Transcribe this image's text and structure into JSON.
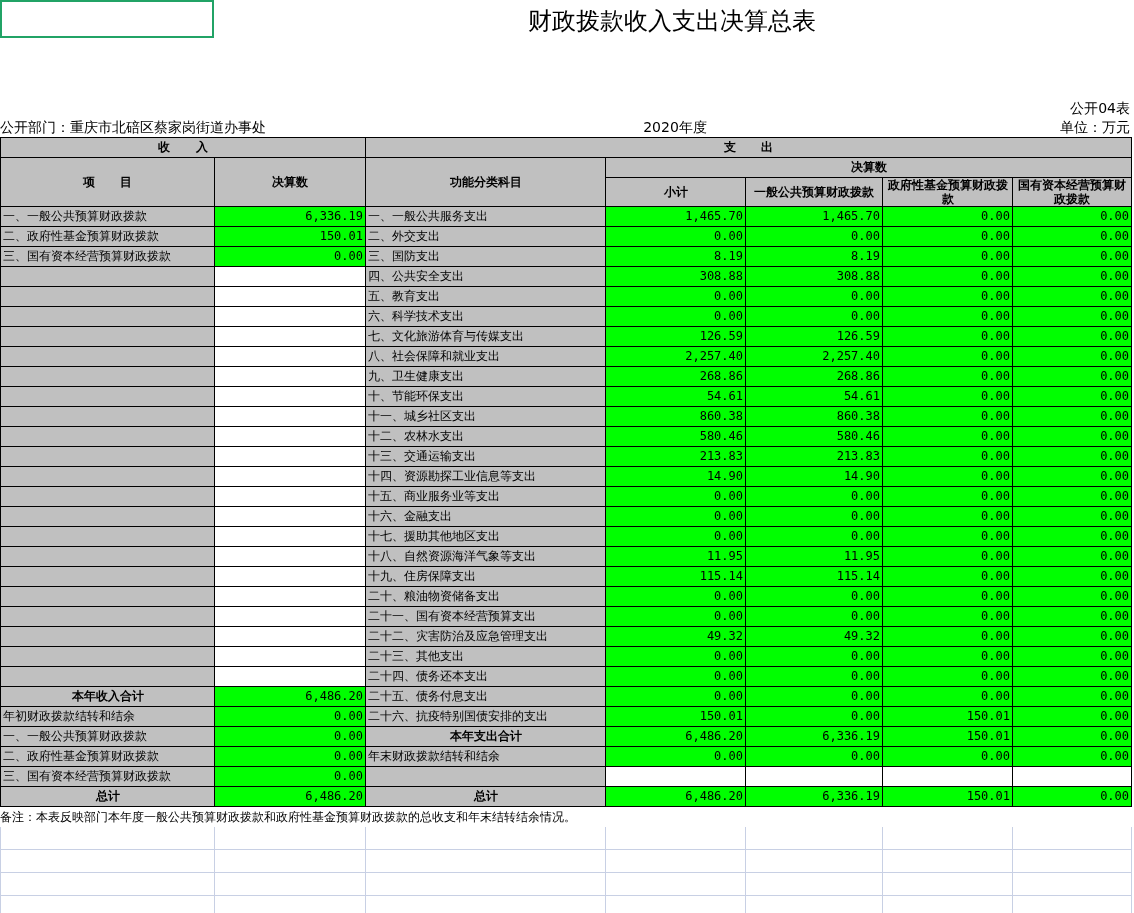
{
  "header": {
    "title": "财政拨款收入支出决算总表",
    "table_no": "公开04表",
    "department": "公开部门：重庆市北碚区蔡家岗街道办事处",
    "year": "2020年度",
    "unit": "单位：万元"
  },
  "columns": {
    "income_group": "收      入",
    "income_item": "项      目",
    "income_amount": "决算数",
    "expense_group": "支      出",
    "expense_item": "功能分类科目",
    "expense_amount_group": "决算数",
    "expense_amounts": [
      "小计",
      "一般公共预算财政拨款",
      "政府性基金预算财政拨款",
      "国有资本经营预算财政拨款"
    ]
  },
  "rows": [
    {
      "income": {
        "kind": "item",
        "label": "一、一般公共预算财政拨款",
        "amount": "6,336.19"
      },
      "expense": {
        "kind": "item",
        "label": "一、一般公共服务支出",
        "amounts": [
          "1,465.70",
          "1,465.70",
          "0.00",
          "0.00"
        ]
      }
    },
    {
      "income": {
        "kind": "item",
        "label": "二、政府性基金预算财政拨款",
        "amount": "150.01"
      },
      "expense": {
        "kind": "item",
        "label": "二、外交支出",
        "amounts": [
          "0.00",
          "0.00",
          "0.00",
          "0.00"
        ]
      }
    },
    {
      "income": {
        "kind": "item",
        "label": "三、国有资本经营预算财政拨款",
        "amount": "0.00"
      },
      "expense": {
        "kind": "item",
        "label": "三、国防支出",
        "amounts": [
          "8.19",
          "8.19",
          "0.00",
          "0.00"
        ]
      }
    },
    {
      "income": {
        "kind": "item"
      },
      "expense": {
        "kind": "item",
        "label": "四、公共安全支出",
        "amounts": [
          "308.88",
          "308.88",
          "0.00",
          "0.00"
        ]
      }
    },
    {
      "income": {
        "kind": "item"
      },
      "expense": {
        "kind": "item",
        "label": "五、教育支出",
        "amounts": [
          "0.00",
          "0.00",
          "0.00",
          "0.00"
        ]
      }
    },
    {
      "income": {
        "kind": "item"
      },
      "expense": {
        "kind": "item",
        "label": "六、科学技术支出",
        "amounts": [
          "0.00",
          "0.00",
          "0.00",
          "0.00"
        ]
      }
    },
    {
      "income": {
        "kind": "item"
      },
      "expense": {
        "kind": "item",
        "label": "七、文化旅游体育与传媒支出",
        "amounts": [
          "126.59",
          "126.59",
          "0.00",
          "0.00"
        ]
      }
    },
    {
      "income": {
        "kind": "item"
      },
      "expense": {
        "kind": "item",
        "label": "八、社会保障和就业支出",
        "amounts": [
          "2,257.40",
          "2,257.40",
          "0.00",
          "0.00"
        ]
      }
    },
    {
      "income": {
        "kind": "item"
      },
      "expense": {
        "kind": "item",
        "label": "九、卫生健康支出",
        "amounts": [
          "268.86",
          "268.86",
          "0.00",
          "0.00"
        ]
      }
    },
    {
      "income": {
        "kind": "item"
      },
      "expense": {
        "kind": "item",
        "label": "十、节能环保支出",
        "amounts": [
          "54.61",
          "54.61",
          "0.00",
          "0.00"
        ]
      }
    },
    {
      "income": {
        "kind": "item"
      },
      "expense": {
        "kind": "item",
        "label": "十一、城乡社区支出",
        "amounts": [
          "860.38",
          "860.38",
          "0.00",
          "0.00"
        ]
      }
    },
    {
      "income": {
        "kind": "item"
      },
      "expense": {
        "kind": "item",
        "label": "十二、农林水支出",
        "amounts": [
          "580.46",
          "580.46",
          "0.00",
          "0.00"
        ]
      }
    },
    {
      "income": {
        "kind": "item"
      },
      "expense": {
        "kind": "item",
        "label": "十三、交通运输支出",
        "amounts": [
          "213.83",
          "213.83",
          "0.00",
          "0.00"
        ]
      }
    },
    {
      "income": {
        "kind": "item"
      },
      "expense": {
        "kind": "item",
        "label": "十四、资源勘探工业信息等支出",
        "amounts": [
          "14.90",
          "14.90",
          "0.00",
          "0.00"
        ]
      }
    },
    {
      "income": {
        "kind": "item"
      },
      "expense": {
        "kind": "item",
        "label": "十五、商业服务业等支出",
        "amounts": [
          "0.00",
          "0.00",
          "0.00",
          "0.00"
        ]
      }
    },
    {
      "income": {
        "kind": "item"
      },
      "expense": {
        "kind": "item",
        "label": "十六、金融支出",
        "amounts": [
          "0.00",
          "0.00",
          "0.00",
          "0.00"
        ]
      }
    },
    {
      "income": {
        "kind": "item"
      },
      "expense": {
        "kind": "item",
        "label": "十七、援助其他地区支出",
        "amounts": [
          "0.00",
          "0.00",
          "0.00",
          "0.00"
        ]
      }
    },
    {
      "income": {
        "kind": "item"
      },
      "expense": {
        "kind": "item",
        "label": "十八、自然资源海洋气象等支出",
        "amounts": [
          "11.95",
          "11.95",
          "0.00",
          "0.00"
        ]
      }
    },
    {
      "income": {
        "kind": "item"
      },
      "expense": {
        "kind": "item",
        "label": "十九、住房保障支出",
        "amounts": [
          "115.14",
          "115.14",
          "0.00",
          "0.00"
        ]
      }
    },
    {
      "income": {
        "kind": "item"
      },
      "expense": {
        "kind": "item",
        "label": "二十、粮油物资储备支出",
        "amounts": [
          "0.00",
          "0.00",
          "0.00",
          "0.00"
        ]
      }
    },
    {
      "income": {
        "kind": "item"
      },
      "expense": {
        "kind": "item",
        "label": "二十一、国有资本经营预算支出",
        "amounts": [
          "0.00",
          "0.00",
          "0.00",
          "0.00"
        ]
      }
    },
    {
      "income": {
        "kind": "item"
      },
      "expense": {
        "kind": "item",
        "label": "二十二、灾害防治及应急管理支出",
        "amounts": [
          "49.32",
          "49.32",
          "0.00",
          "0.00"
        ]
      }
    },
    {
      "income": {
        "kind": "item"
      },
      "expense": {
        "kind": "item",
        "label": "二十三、其他支出",
        "amounts": [
          "0.00",
          "0.00",
          "0.00",
          "0.00"
        ]
      }
    },
    {
      "income": {
        "kind": "item"
      },
      "expense": {
        "kind": "item",
        "label": "二十四、债务还本支出",
        "amounts": [
          "0.00",
          "0.00",
          "0.00",
          "0.00"
        ]
      }
    },
    {
      "income": {
        "kind": "total",
        "label": "本年收入合计",
        "amount": "6,486.20"
      },
      "expense": {
        "kind": "item",
        "label": "二十五、债务付息支出",
        "amounts": [
          "0.00",
          "0.00",
          "0.00",
          "0.00"
        ]
      }
    },
    {
      "income": {
        "kind": "item",
        "label": "年初财政拨款结转和结余",
        "amount": "0.00"
      },
      "expense": {
        "kind": "item",
        "label": "二十六、抗疫特别国债安排的支出",
        "amounts": [
          "150.01",
          "0.00",
          "150.01",
          "0.00"
        ]
      }
    },
    {
      "income": {
        "kind": "item",
        "label": "一、一般公共预算财政拨款",
        "amount": "0.00"
      },
      "expense": {
        "kind": "total",
        "label": "本年支出合计",
        "amounts": [
          "6,486.20",
          "6,336.19",
          "150.01",
          "0.00"
        ]
      }
    },
    {
      "income": {
        "kind": "item",
        "label": "二、政府性基金预算财政拨款",
        "amount": "0.00"
      },
      "expense": {
        "kind": "item",
        "label": "年末财政拨款结转和结余",
        "amounts": [
          "0.00",
          "0.00",
          "0.00",
          "0.00"
        ]
      }
    },
    {
      "income": {
        "kind": "item",
        "label": "三、国有资本经营预算财政拨款",
        "amount": "0.00"
      },
      "expense": {
        "kind": "item"
      }
    },
    {
      "income": {
        "kind": "total",
        "label": "总计",
        "amount": "6,486.20"
      },
      "expense": {
        "kind": "total",
        "label": "总计",
        "amounts": [
          "6,486.20",
          "6,336.19",
          "150.01",
          "0.00"
        ]
      }
    }
  ],
  "note": "备注：本表反映部门本年度一般公共预算财政拨款和政府性基金预算财政拨款的总收支和年末结转结余情况。"
}
